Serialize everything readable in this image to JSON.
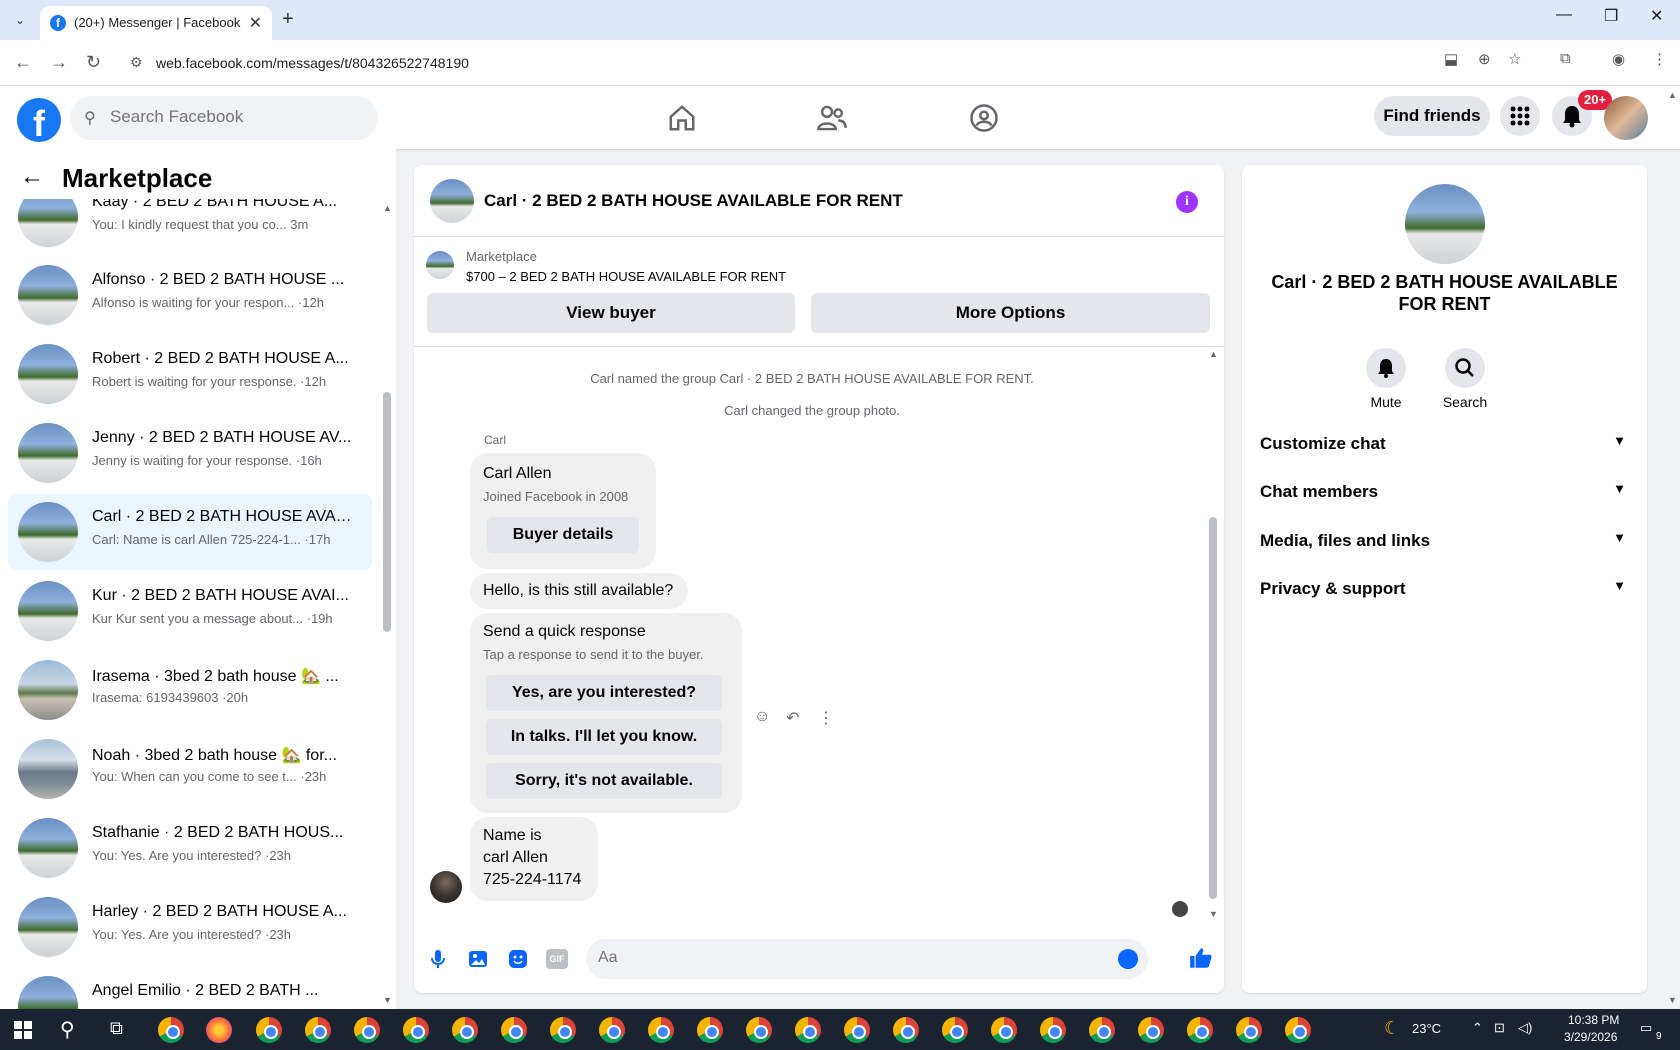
{
  "browser": {
    "tab_title": "(20+) Messenger | Facebook",
    "url": "web.facebook.com/messages/t/804326522748190"
  },
  "header": {
    "search_placeholder": "Search Facebook",
    "find_friends": "Find friends",
    "notification_badge": "20+"
  },
  "sidebar": {
    "title": "Marketplace",
    "conversations": [
      {
        "name": "Kaay · 2 BED 2 BATH HOUSE A...",
        "preview": "You: I kindly request that you co... 3m",
        "active": false
      },
      {
        "name": "Alfonso · 2 BED 2 BATH HOUSE ...",
        "preview": "Alfonso is waiting for your respon... ·12h",
        "active": false
      },
      {
        "name": "Robert · 2 BED 2 BATH HOUSE A...",
        "preview": "Robert is waiting for your response. ·12h",
        "active": false
      },
      {
        "name": "Jenny · 2 BED 2 BATH HOUSE AV...",
        "preview": "Jenny is waiting for your response. ·16h",
        "active": false
      },
      {
        "name": "Carl · 2 BED 2 BATH HOUSE AVAI...",
        "preview": "Carl: Name is carl Allen 725-224-1... ·17h",
        "active": true
      },
      {
        "name": "Kur · 2 BED 2 BATH HOUSE AVAI...",
        "preview": "Kur Kur sent you a message about... ·19h",
        "active": false
      },
      {
        "name": "Irasema · 3bed 2 bath house 🏡 ...",
        "preview": "Irasema: 6193439603 ·20h",
        "active": false
      },
      {
        "name": "Noah · 3bed 2 bath house 🏡 for...",
        "preview": "You: When can you come to see t... ·23h",
        "active": false
      },
      {
        "name": "Stafhanie · 2 BED 2 BATH HOUS...",
        "preview": "You: Yes. Are you interested? ·23h",
        "active": false
      },
      {
        "name": "Harley · 2 BED 2 BATH HOUSE A...",
        "preview": "You: Yes. Are you interested? ·23h",
        "active": false
      },
      {
        "name": "Angel Emilio · 2 BED 2 BATH ...",
        "preview": "",
        "active": false
      }
    ]
  },
  "chat": {
    "title": "Carl · 2 BED 2 BATH HOUSE AVAILABLE FOR RENT",
    "marketplace_label": "Marketplace",
    "listing": "$700 – 2 BED 2 BATH HOUSE AVAILABLE FOR RENT",
    "view_buyer": "View buyer",
    "more_options": "More Options",
    "system_messages": [
      "Carl named the group Carl · 2 BED 2 BATH HOUSE AVAILABLE FOR RENT.",
      "Carl changed the group photo."
    ],
    "sender": "Carl",
    "profile_card": {
      "name": "Carl Allen",
      "sub": "Joined Facebook in 2008",
      "button": "Buyer details"
    },
    "msg1": "Hello, is this still available?",
    "quick_response": {
      "title": "Send a quick response",
      "sub": "Tap a response to send it to the buyer.",
      "options": [
        "Yes, are you interested?",
        "In talks. I'll let you know.",
        "Sorry, it's not available."
      ]
    },
    "msg2": [
      "Name is",
      "carl Allen",
      "725-224-1174"
    ],
    "composer_placeholder": "Aa",
    "gif_label": "GIF"
  },
  "right_panel": {
    "name": "Carl · 2 BED 2 BATH HOUSE AVAILABLE FOR RENT",
    "mute": "Mute",
    "search": "Search",
    "sections": [
      "Customize chat",
      "Chat members",
      "Media, files and links",
      "Privacy & support"
    ]
  },
  "taskbar": {
    "weather": "23°C",
    "time": "10:38 PM",
    "date": "3/29/2026",
    "notif_count": "9"
  }
}
